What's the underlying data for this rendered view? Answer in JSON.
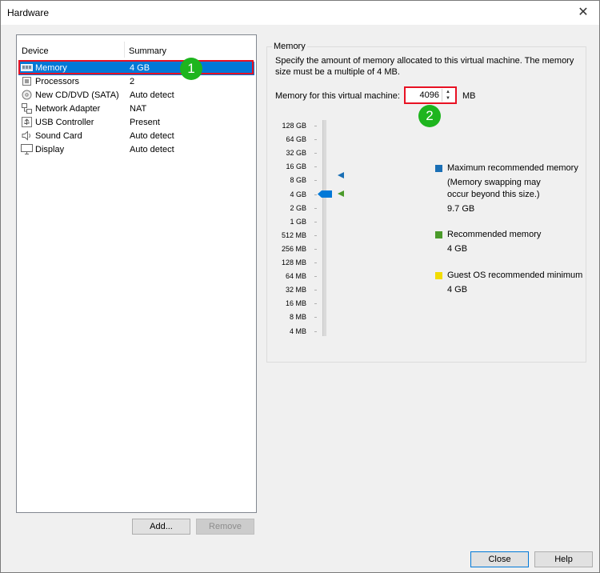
{
  "window": {
    "title": "Hardware",
    "close_glyph": "✕"
  },
  "device_table": {
    "headers": {
      "device": "Device",
      "summary": "Summary"
    },
    "rows": [
      {
        "name": "Memory",
        "summary": "4 GB",
        "icon": "memory-icon",
        "selected": true
      },
      {
        "name": "Processors",
        "summary": "2",
        "icon": "processor-icon"
      },
      {
        "name": "New CD/DVD (SATA)",
        "summary": "Auto detect",
        "icon": "cd-dvd-icon"
      },
      {
        "name": "Network Adapter",
        "summary": "NAT",
        "icon": "network-adapter-icon"
      },
      {
        "name": "USB Controller",
        "summary": "Present",
        "icon": "usb-icon"
      },
      {
        "name": "Sound Card",
        "summary": "Auto detect",
        "icon": "sound-icon"
      },
      {
        "name": "Display",
        "summary": "Auto detect",
        "icon": "display-icon"
      }
    ]
  },
  "buttons": {
    "add": "Add...",
    "remove": "Remove",
    "close": "Close",
    "help": "Help"
  },
  "annotations": {
    "badge1": "1",
    "badge2": "2"
  },
  "memory": {
    "group_title": "Memory",
    "description": "Specify the amount of memory allocated to this virtual machine. The memory size must be a multiple of 4 MB.",
    "field_label": "Memory for this virtual machine:",
    "value": "4096",
    "unit": "MB",
    "scale_labels": [
      "128 GB",
      "64 GB",
      "32 GB",
      "16 GB",
      "8 GB",
      "4 GB",
      "2 GB",
      "1 GB",
      "512 MB",
      "256 MB",
      "128 MB",
      "64 MB",
      "32 MB",
      "16 MB",
      "8 MB",
      "4 MB"
    ],
    "legend": {
      "max_title": "Maximum recommended memory",
      "max_note": "(Memory swapping may occur beyond this size.)",
      "max_value": "9.7 GB",
      "rec_title": "Recommended memory",
      "rec_value": "4 GB",
      "min_title": "Guest OS recommended minimum",
      "min_value": "4 GB"
    },
    "colors": {
      "max": "#1a6fb5",
      "recommended": "#4a9a2a",
      "minimum": "#f2dc00",
      "accent": "#0078d7",
      "highlight": "#e81123",
      "badge": "#1eb51e"
    }
  }
}
